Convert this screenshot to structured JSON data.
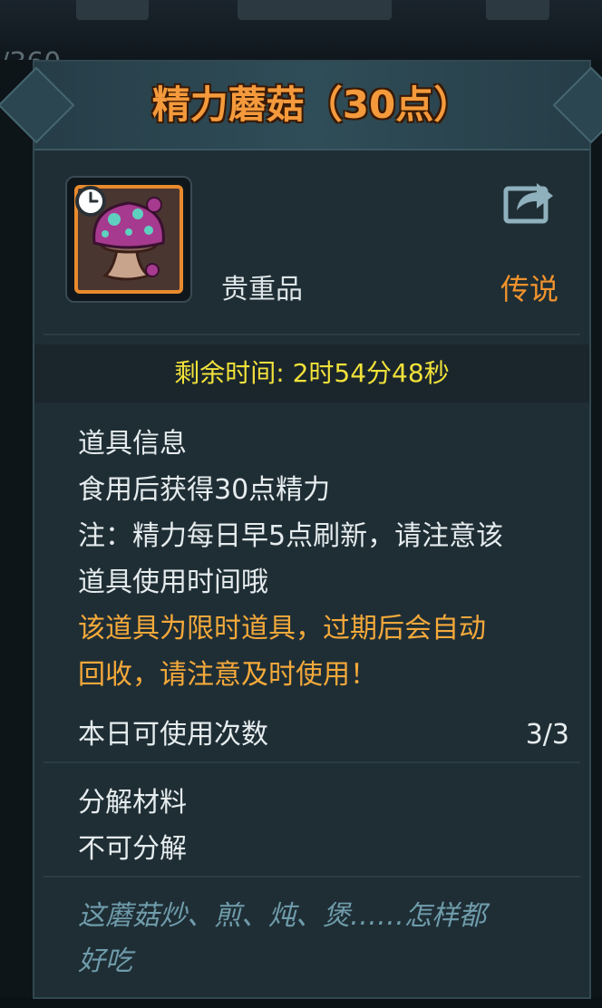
{
  "background": {
    "counter_text": "/360"
  },
  "popup": {
    "title": "精力蘑菇（30点）",
    "item": {
      "icon": "purple-mushroom-icon",
      "category": "贵重品",
      "rarity": "传说"
    },
    "timer": "剩余时间: 2时54分48秒",
    "info": {
      "heading": "道具信息",
      "lines": [
        "食用后获得30点精力",
        "注：精力每日早5点刷新，请注意该",
        "道具使用时间哦"
      ],
      "warning_lines": [
        "该道具为限时道具，过期后会自动",
        "回收，请注意及时使用！"
      ]
    },
    "daily_uses": {
      "label": "本日可使用次数",
      "value": "3/3"
    },
    "decompose": {
      "heading": "分解材料",
      "value": "不可分解"
    },
    "flavor_lines": [
      "这蘑菇炒、煎、炖、煲……怎样都",
      "好吃"
    ]
  },
  "colors": {
    "title": "#f49a3c",
    "timer": "#f2e13a",
    "warning": "#f5a93a",
    "rarity": "#f0932d",
    "flavor": "#6f9cab",
    "panel": "#1f2e35"
  }
}
